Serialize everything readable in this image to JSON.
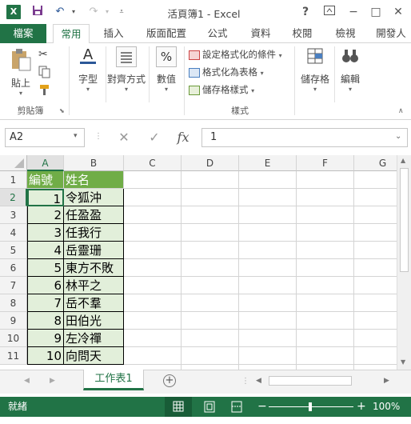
{
  "title": "活頁簿1 - Excel",
  "window_controls": {
    "help": "?",
    "restore": "□",
    "minimize": "−",
    "maximize": "□",
    "close": "✕"
  },
  "tabs": [
    "檔案",
    "常用",
    "插入",
    "版面配置",
    "公式",
    "資料",
    "校閱",
    "檢視",
    "開發人"
  ],
  "ribbon": {
    "clipboard": {
      "paste": "貼上",
      "group": "剪貼簿"
    },
    "font": "字型",
    "alignment": "對齊方式",
    "number": "數值",
    "number_symbol": "%",
    "styles": {
      "conditional": "設定格式化的條件",
      "table": "格式化為表格",
      "cell_styles": "儲存格樣式",
      "group": "樣式"
    },
    "cells": "儲存格",
    "editing": "編輯"
  },
  "formula_bar": {
    "name_box": "A2",
    "fx": "fx",
    "value": "1"
  },
  "columns": [
    "A",
    "B",
    "C",
    "D",
    "E",
    "F",
    "G"
  ],
  "rows": [
    "1",
    "2",
    "3",
    "4",
    "5",
    "6",
    "7",
    "8",
    "9",
    "10",
    "11"
  ],
  "table": {
    "headers": [
      "編號",
      "姓名"
    ],
    "data": [
      [
        "1",
        "令狐沖"
      ],
      [
        "2",
        "任盈盈"
      ],
      [
        "3",
        "任我行"
      ],
      [
        "4",
        "岳靈珊"
      ],
      [
        "5",
        "東方不敗"
      ],
      [
        "6",
        "林平之"
      ],
      [
        "7",
        "岳不羣"
      ],
      [
        "8",
        "田伯光"
      ],
      [
        "9",
        "左冷禪"
      ],
      [
        "10",
        "向問天"
      ]
    ]
  },
  "sheet_tab": "工作表1",
  "status": {
    "ready": "就緒",
    "zoom": "100%"
  },
  "colors": {
    "brand": "#217346",
    "header_fill": "#70ad47",
    "band_fill": "#e2efda"
  }
}
